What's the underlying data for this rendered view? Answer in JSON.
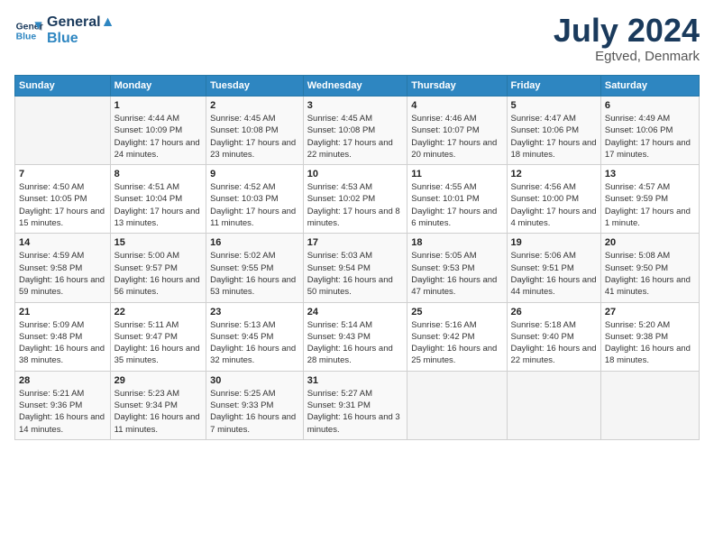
{
  "header": {
    "logo_line1": "General",
    "logo_line2": "Blue",
    "title": "July 2024",
    "subtitle": "Egtved, Denmark"
  },
  "days_of_week": [
    "Sunday",
    "Monday",
    "Tuesday",
    "Wednesday",
    "Thursday",
    "Friday",
    "Saturday"
  ],
  "weeks": [
    [
      {
        "day": "",
        "sunrise": "",
        "sunset": "",
        "daylight": ""
      },
      {
        "day": "1",
        "sunrise": "Sunrise: 4:44 AM",
        "sunset": "Sunset: 10:09 PM",
        "daylight": "Daylight: 17 hours and 24 minutes."
      },
      {
        "day": "2",
        "sunrise": "Sunrise: 4:45 AM",
        "sunset": "Sunset: 10:08 PM",
        "daylight": "Daylight: 17 hours and 23 minutes."
      },
      {
        "day": "3",
        "sunrise": "Sunrise: 4:45 AM",
        "sunset": "Sunset: 10:08 PM",
        "daylight": "Daylight: 17 hours and 22 minutes."
      },
      {
        "day": "4",
        "sunrise": "Sunrise: 4:46 AM",
        "sunset": "Sunset: 10:07 PM",
        "daylight": "Daylight: 17 hours and 20 minutes."
      },
      {
        "day": "5",
        "sunrise": "Sunrise: 4:47 AM",
        "sunset": "Sunset: 10:06 PM",
        "daylight": "Daylight: 17 hours and 18 minutes."
      },
      {
        "day": "6",
        "sunrise": "Sunrise: 4:49 AM",
        "sunset": "Sunset: 10:06 PM",
        "daylight": "Daylight: 17 hours and 17 minutes."
      }
    ],
    [
      {
        "day": "7",
        "sunrise": "Sunrise: 4:50 AM",
        "sunset": "Sunset: 10:05 PM",
        "daylight": "Daylight: 17 hours and 15 minutes."
      },
      {
        "day": "8",
        "sunrise": "Sunrise: 4:51 AM",
        "sunset": "Sunset: 10:04 PM",
        "daylight": "Daylight: 17 hours and 13 minutes."
      },
      {
        "day": "9",
        "sunrise": "Sunrise: 4:52 AM",
        "sunset": "Sunset: 10:03 PM",
        "daylight": "Daylight: 17 hours and 11 minutes."
      },
      {
        "day": "10",
        "sunrise": "Sunrise: 4:53 AM",
        "sunset": "Sunset: 10:02 PM",
        "daylight": "Daylight: 17 hours and 8 minutes."
      },
      {
        "day": "11",
        "sunrise": "Sunrise: 4:55 AM",
        "sunset": "Sunset: 10:01 PM",
        "daylight": "Daylight: 17 hours and 6 minutes."
      },
      {
        "day": "12",
        "sunrise": "Sunrise: 4:56 AM",
        "sunset": "Sunset: 10:00 PM",
        "daylight": "Daylight: 17 hours and 4 minutes."
      },
      {
        "day": "13",
        "sunrise": "Sunrise: 4:57 AM",
        "sunset": "Sunset: 9:59 PM",
        "daylight": "Daylight: 17 hours and 1 minute."
      }
    ],
    [
      {
        "day": "14",
        "sunrise": "Sunrise: 4:59 AM",
        "sunset": "Sunset: 9:58 PM",
        "daylight": "Daylight: 16 hours and 59 minutes."
      },
      {
        "day": "15",
        "sunrise": "Sunrise: 5:00 AM",
        "sunset": "Sunset: 9:57 PM",
        "daylight": "Daylight: 16 hours and 56 minutes."
      },
      {
        "day": "16",
        "sunrise": "Sunrise: 5:02 AM",
        "sunset": "Sunset: 9:55 PM",
        "daylight": "Daylight: 16 hours and 53 minutes."
      },
      {
        "day": "17",
        "sunrise": "Sunrise: 5:03 AM",
        "sunset": "Sunset: 9:54 PM",
        "daylight": "Daylight: 16 hours and 50 minutes."
      },
      {
        "day": "18",
        "sunrise": "Sunrise: 5:05 AM",
        "sunset": "Sunset: 9:53 PM",
        "daylight": "Daylight: 16 hours and 47 minutes."
      },
      {
        "day": "19",
        "sunrise": "Sunrise: 5:06 AM",
        "sunset": "Sunset: 9:51 PM",
        "daylight": "Daylight: 16 hours and 44 minutes."
      },
      {
        "day": "20",
        "sunrise": "Sunrise: 5:08 AM",
        "sunset": "Sunset: 9:50 PM",
        "daylight": "Daylight: 16 hours and 41 minutes."
      }
    ],
    [
      {
        "day": "21",
        "sunrise": "Sunrise: 5:09 AM",
        "sunset": "Sunset: 9:48 PM",
        "daylight": "Daylight: 16 hours and 38 minutes."
      },
      {
        "day": "22",
        "sunrise": "Sunrise: 5:11 AM",
        "sunset": "Sunset: 9:47 PM",
        "daylight": "Daylight: 16 hours and 35 minutes."
      },
      {
        "day": "23",
        "sunrise": "Sunrise: 5:13 AM",
        "sunset": "Sunset: 9:45 PM",
        "daylight": "Daylight: 16 hours and 32 minutes."
      },
      {
        "day": "24",
        "sunrise": "Sunrise: 5:14 AM",
        "sunset": "Sunset: 9:43 PM",
        "daylight": "Daylight: 16 hours and 28 minutes."
      },
      {
        "day": "25",
        "sunrise": "Sunrise: 5:16 AM",
        "sunset": "Sunset: 9:42 PM",
        "daylight": "Daylight: 16 hours and 25 minutes."
      },
      {
        "day": "26",
        "sunrise": "Sunrise: 5:18 AM",
        "sunset": "Sunset: 9:40 PM",
        "daylight": "Daylight: 16 hours and 22 minutes."
      },
      {
        "day": "27",
        "sunrise": "Sunrise: 5:20 AM",
        "sunset": "Sunset: 9:38 PM",
        "daylight": "Daylight: 16 hours and 18 minutes."
      }
    ],
    [
      {
        "day": "28",
        "sunrise": "Sunrise: 5:21 AM",
        "sunset": "Sunset: 9:36 PM",
        "daylight": "Daylight: 16 hours and 14 minutes."
      },
      {
        "day": "29",
        "sunrise": "Sunrise: 5:23 AM",
        "sunset": "Sunset: 9:34 PM",
        "daylight": "Daylight: 16 hours and 11 minutes."
      },
      {
        "day": "30",
        "sunrise": "Sunrise: 5:25 AM",
        "sunset": "Sunset: 9:33 PM",
        "daylight": "Daylight: 16 hours and 7 minutes."
      },
      {
        "day": "31",
        "sunrise": "Sunrise: 5:27 AM",
        "sunset": "Sunset: 9:31 PM",
        "daylight": "Daylight: 16 hours and 3 minutes."
      },
      {
        "day": "",
        "sunrise": "",
        "sunset": "",
        "daylight": ""
      },
      {
        "day": "",
        "sunrise": "",
        "sunset": "",
        "daylight": ""
      },
      {
        "day": "",
        "sunrise": "",
        "sunset": "",
        "daylight": ""
      }
    ]
  ]
}
